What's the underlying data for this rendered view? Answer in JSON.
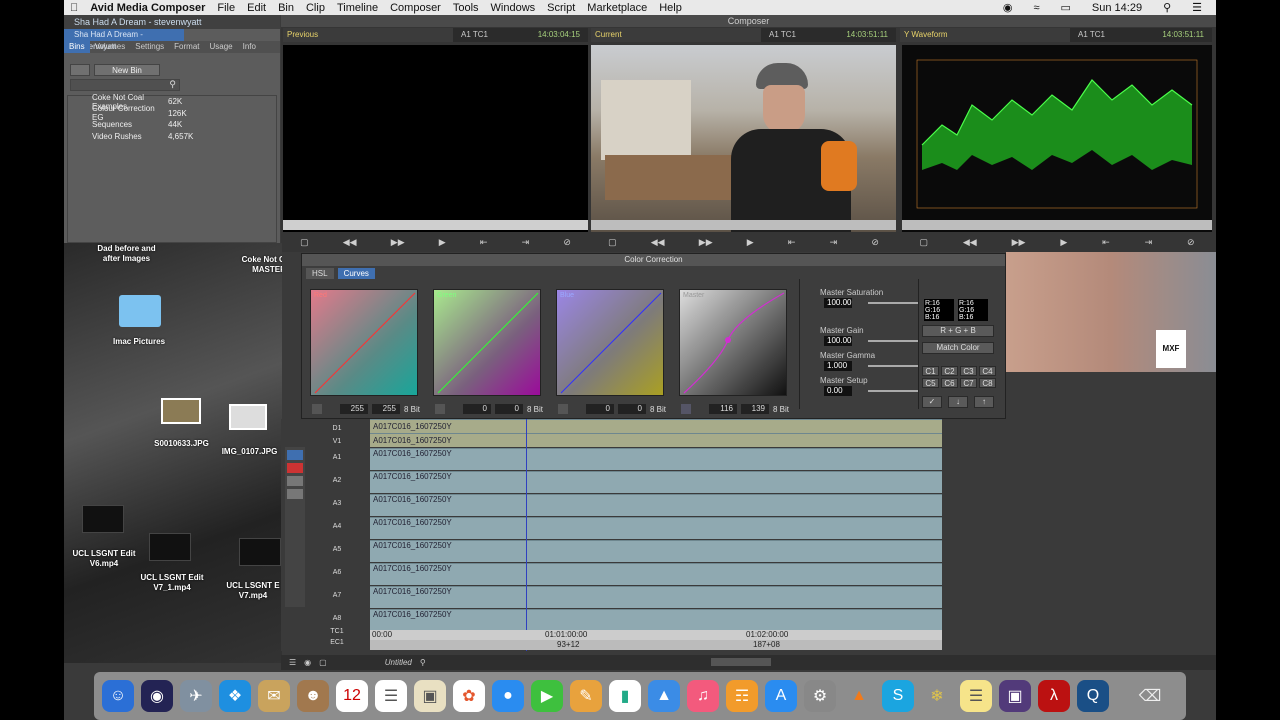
{
  "menubar": {
    "app": "Avid Media Composer",
    "items": [
      "File",
      "Edit",
      "Bin",
      "Clip",
      "Timeline",
      "Composer",
      "Tools",
      "Windows",
      "Script",
      "Marketplace",
      "Help"
    ],
    "clock": "Sun 14:29"
  },
  "bins": {
    "title": "Sha Had A Dream - stevenwyatt",
    "tab_title": "Sha Had A Dream - stevenwyatt",
    "tabs": [
      "Bins",
      "Volumes",
      "Settings",
      "Format",
      "Usage",
      "Info"
    ],
    "new_bin": "New Bin",
    "rows": [
      {
        "name": "Coke Not Coal Examples",
        "size": "62K"
      },
      {
        "name": "Colour Correction EG",
        "size": "126K"
      },
      {
        "name": "Sequences",
        "size": "44K"
      },
      {
        "name": "Video Rushes",
        "size": "4,657K"
      }
    ]
  },
  "composer": {
    "title": "Composer",
    "monitors": [
      {
        "source": "Previous",
        "tc_label": "A1 TC1",
        "tc": "14:03:04:15"
      },
      {
        "source": "Current",
        "tc_label": "A1 TC1",
        "tc": "14:03:51:11"
      },
      {
        "source": "Y Waveform",
        "tc_label": "A1 TC1",
        "tc": "14:03:51:11"
      }
    ]
  },
  "desktop": {
    "items": [
      {
        "label": "Dad before and after Images"
      },
      {
        "label": "Coke Not Coal MASTER"
      },
      {
        "label": "Imac Pictures"
      },
      {
        "label": "S0010633.JPG"
      },
      {
        "label": "IMG_0107.JPG"
      },
      {
        "label": "UCL LSGNT Edit V6.mp4"
      },
      {
        "label": "UCL LSGNT Edit V7_1.mp4"
      },
      {
        "label": "UCL LSGNT E V7.mp4"
      }
    ]
  },
  "color_correction": {
    "title": "Color Correction",
    "tabs": [
      "HSL",
      "Curves"
    ],
    "curves": [
      {
        "name": "Red",
        "in": "255",
        "out": "255",
        "bits": "8 Bit"
      },
      {
        "name": "Green",
        "in": "0",
        "out": "0",
        "bits": "8 Bit"
      },
      {
        "name": "Blue",
        "in": "0",
        "out": "0",
        "bits": "8 Bit"
      },
      {
        "name": "Master",
        "in": "116",
        "out": "139",
        "bits": "8 Bit"
      }
    ],
    "master": [
      {
        "label": "Master Saturation",
        "value": "100.00"
      },
      {
        "label": "Master Gain",
        "value": "100.00"
      },
      {
        "label": "Master Gamma",
        "value": "1.000"
      },
      {
        "label": "Master Setup",
        "value": "0.00"
      }
    ],
    "rgb_readout": {
      "left": [
        "R:16",
        "G:16",
        "B:16"
      ],
      "right": [
        "R:16",
        "G:16",
        "B:16"
      ]
    },
    "rgb_mode": "R + G + B",
    "match_color": "Match Color",
    "buckets": [
      "C1",
      "C2",
      "C3",
      "C4",
      "C5",
      "C6",
      "C7",
      "C8"
    ]
  },
  "timeline": {
    "tracks": [
      {
        "name": "D1",
        "clip": "A017C016_1607250Y"
      },
      {
        "name": "V1",
        "clip": "A017C016_1607250Y"
      },
      {
        "name": "A1",
        "clip": "A017C016_1607250Y"
      },
      {
        "name": "A2",
        "clip": "A017C016_1607250Y"
      },
      {
        "name": "A3",
        "clip": "A017C016_1607250Y"
      },
      {
        "name": "A4",
        "clip": "A017C016_1607250Y"
      },
      {
        "name": "A5",
        "clip": "A017C016_1607250Y"
      },
      {
        "name": "A6",
        "clip": "A017C016_1607250Y"
      },
      {
        "name": "A7",
        "clip": "A017C016_1607250Y"
      },
      {
        "name": "A8",
        "clip": "A017C016_1607250Y"
      }
    ],
    "tc1_label": "TC1",
    "ec1_label": "EC1",
    "tc_marks": [
      "00:00",
      "01:01:00:00",
      "01:02:00:00"
    ],
    "ec_marks": [
      "93+12",
      "187+08"
    ],
    "sequence_name": "Untitled"
  },
  "colors": {
    "accent": "#3f6fb0",
    "tc_green": "#a7d17d",
    "waveform": "#2bff2b",
    "track": "#8fa9b1"
  }
}
